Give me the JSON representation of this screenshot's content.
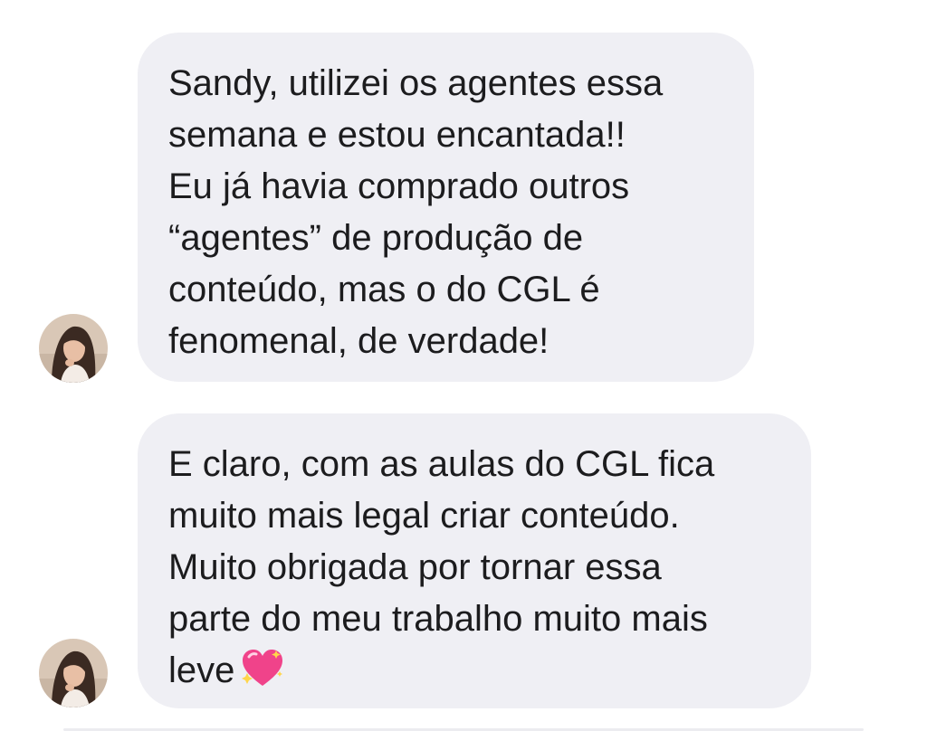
{
  "messages": [
    {
      "lines": [
        "Sandy, utilizei os agentes essa",
        "semana e estou encantada!!",
        "Eu já havia comprado outros",
        "“agentes” de produção de",
        "conteúdo, mas o do CGL é",
        "fenomenal, de verdade!"
      ]
    },
    {
      "lines": [
        "E claro, com as aulas do CGL fica",
        "muito mais legal criar conteúdo.",
        "Muito obrigada por tornar essa",
        "parte do meu trabalho muito mais",
        "leve"
      ],
      "emoji": "sparkling-heart"
    }
  ],
  "colors": {
    "bubble": "#efeff4",
    "text": "#1c1c1e",
    "background": "#ffffff",
    "heart": "#f0438a"
  }
}
